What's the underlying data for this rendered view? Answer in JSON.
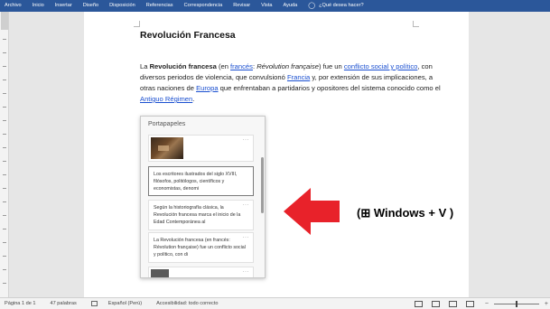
{
  "ribbon": {
    "tabs": [
      "Archivo",
      "Inicio",
      "Insertar",
      "Diseño",
      "Disposición",
      "Referencias",
      "Correspondencia",
      "Revisar",
      "Vista",
      "Ayuda"
    ],
    "tell_me": "¿Qué desea hacer?"
  },
  "document": {
    "title": "Revolución Francesa",
    "p_a": "La ",
    "p_bold": "Revolución francesa",
    "p_b": " (en ",
    "p_link_frances": "francés",
    "p_c": ": ",
    "p_italic": "Révolution française",
    "p_d": ") fue un ",
    "p_link_conflicto": "conflicto social y político",
    "p_e": ", con diversos periodos de violencia, que convulsionó ",
    "p_link_francia": "Francia",
    "p_f": " y, por extensión de sus implicaciones, a otras naciones de ",
    "p_link_europa": "Europa",
    "p_g": " que enfrentaban a partidarios y opositores del sistema conocido como el ",
    "p_link_antiguo": "Antiguo Régimen",
    "p_h": "."
  },
  "clipboard": {
    "title": "Portapapeles",
    "dots": "···",
    "items": [
      {
        "type": "image"
      },
      {
        "type": "text",
        "text": "Los escritores ilustrados del siglo XVIII, filósofos, politólogos, científicos y economistas, denomi"
      },
      {
        "type": "text",
        "text": "Según la historiografía clásica, la Revolución francesa marca el inicio de la Edad Contemporánea al"
      },
      {
        "type": "text",
        "text": "La Revolución francesa (en francés: Révolution française) fue un conflicto social y político, con di"
      }
    ]
  },
  "shortcut_label": "(⊞ Windows + V )",
  "arrow_color": "#e8222a",
  "status": {
    "page": "Página 1 de 1",
    "words": "47 palabras",
    "language": "Español (Perú)",
    "accessibility": "Accesibilidad: todo correcto"
  }
}
